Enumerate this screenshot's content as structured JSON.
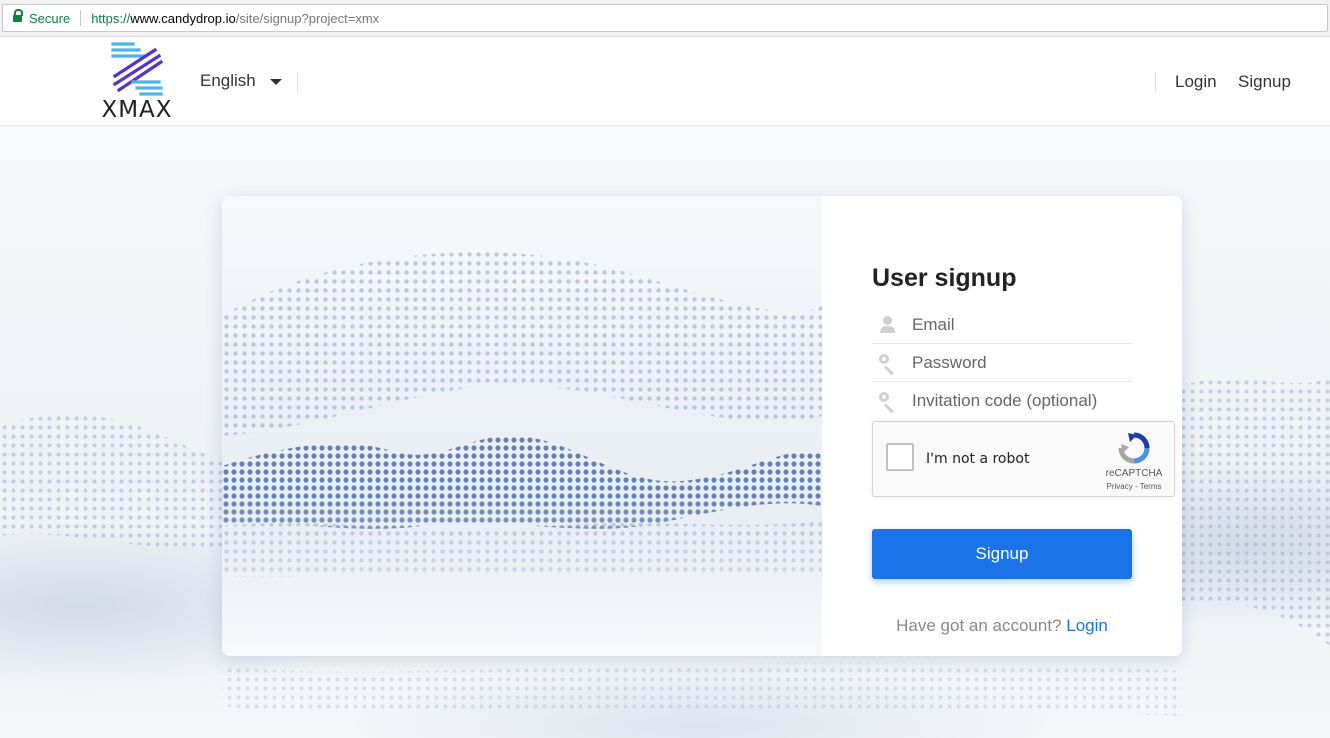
{
  "browser": {
    "secure_label": "Secure",
    "url_scheme": "https://",
    "url_host": "www.candydrop.io",
    "url_path": "/site/signup?project=xmx",
    "secure_color": "#0b8043"
  },
  "header": {
    "logo_text": "XMAX",
    "language": "English",
    "nav": {
      "login": "Login",
      "signup": "Signup"
    }
  },
  "form": {
    "title": "User signup",
    "email_placeholder": "Email",
    "password_placeholder": "Password",
    "invitation_placeholder": "Invitation code (optional)",
    "captcha": {
      "label": "I'm not a robot",
      "brand": "reCAPTCHA",
      "privacy": "Privacy",
      "separator": " - ",
      "terms": "Terms"
    },
    "submit_label": "Signup",
    "account_prompt": "Have got an account?",
    "account_link": "Login",
    "accent_color": "#1a73e8"
  },
  "icons": {
    "email": "user-icon",
    "password": "key-icon",
    "invitation": "key-icon"
  }
}
